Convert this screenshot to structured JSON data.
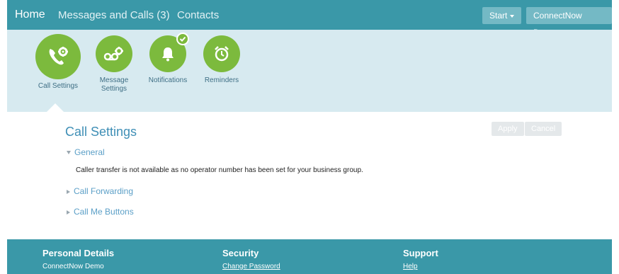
{
  "topnav": {
    "home": "Home",
    "messages": "Messages and Calls (3)",
    "contacts": "Contacts",
    "start_label": "Start",
    "account_label": "ConnectNow Demo"
  },
  "tools": [
    {
      "label": "Call Settings",
      "icon": "phone-gear-icon",
      "active": true
    },
    {
      "label": "Message\nSettings",
      "icon": "voicemail-gear-icon"
    },
    {
      "label": "Notifications",
      "icon": "bell-check-icon"
    },
    {
      "label": "Reminders",
      "icon": "alarm-clock-icon"
    }
  ],
  "main": {
    "title": "Call Settings",
    "apply_label": "Apply",
    "cancel_label": "Cancel",
    "sections": {
      "general": "General",
      "general_note": "Caller transfer is not available as no operator number has been set for your business group.",
      "forwarding": "Call Forwarding",
      "callme": "Call Me Buttons"
    }
  },
  "footer": {
    "personal": {
      "heading": "Personal Details",
      "value": "ConnectNow Demo"
    },
    "security": {
      "heading": "Security",
      "link": "Change Password"
    },
    "support": {
      "heading": "Support",
      "link": "Help"
    }
  },
  "colors": {
    "primary": "#3a98a8",
    "band": "#d7eaf0",
    "green": "#7cba3d",
    "link_blue": "#5b9fc7"
  }
}
